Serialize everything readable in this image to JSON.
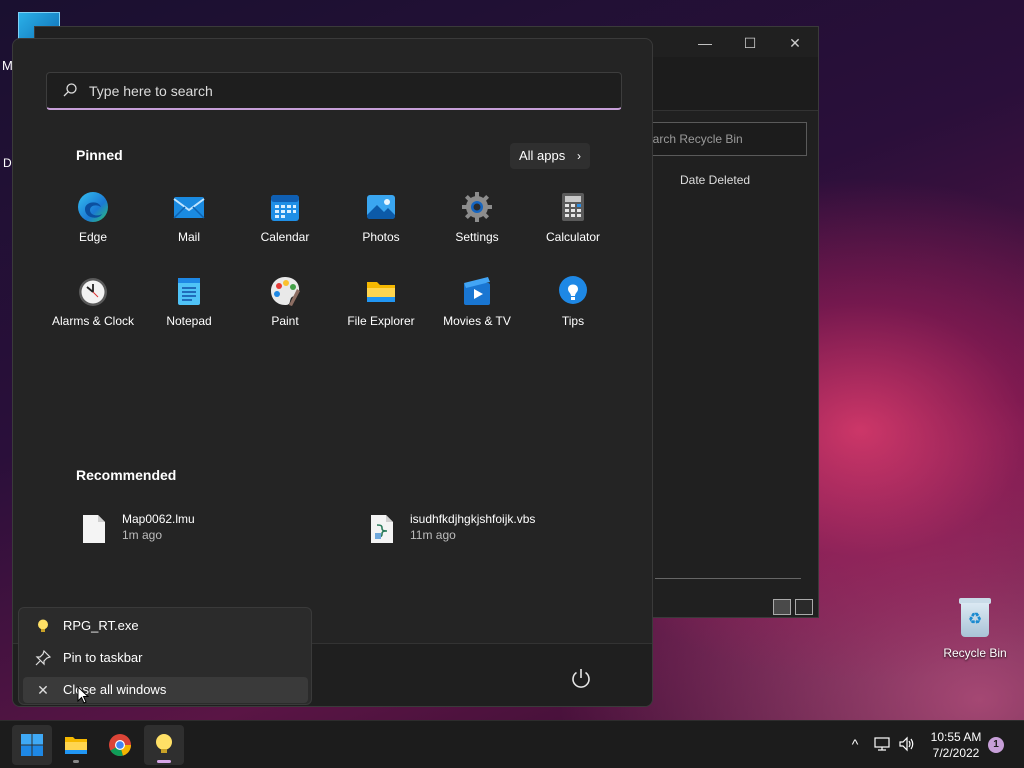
{
  "desktop": {
    "top_left_label_m": "M",
    "top_left_label_d": "D",
    "recycle_bin_label": "Recycle Bin"
  },
  "explorer": {
    "search_placeholder": "Search Recycle Bin",
    "search_visible_text": "earch Recycle Bin",
    "column_header": "Date Deleted",
    "minimize_icon": "minimize-icon",
    "maximize_icon": "maximize-icon",
    "close_icon": "close-icon"
  },
  "start_menu": {
    "search_placeholder": "Type here to search",
    "pinned_title": "Pinned",
    "all_apps_label": "All apps",
    "pinned_apps": [
      {
        "name": "Edge",
        "icon": "edge-icon"
      },
      {
        "name": "Mail",
        "icon": "mail-icon"
      },
      {
        "name": "Calendar",
        "icon": "calendar-icon"
      },
      {
        "name": "Photos",
        "icon": "photos-icon"
      },
      {
        "name": "Settings",
        "icon": "settings-icon"
      },
      {
        "name": "Calculator",
        "icon": "calculator-icon"
      },
      {
        "name": "Alarms & Clock",
        "icon": "clock-icon"
      },
      {
        "name": "Notepad",
        "icon": "notepad-icon"
      },
      {
        "name": "Paint",
        "icon": "paint-icon"
      },
      {
        "name": "File Explorer",
        "icon": "folder-icon"
      },
      {
        "name": "Movies & TV",
        "icon": "movies-icon"
      },
      {
        "name": "Tips",
        "icon": "tips-icon"
      }
    ],
    "recommended_title": "Recommended",
    "recommended": [
      {
        "name": "Map0062.lmu",
        "time": "1m ago",
        "icon": "document-icon"
      },
      {
        "name": "isudhfkdjhgkjshfoijk.vbs",
        "time": "11m ago",
        "icon": "script-icon"
      }
    ]
  },
  "jumplist": {
    "items": [
      {
        "label": "RPG_RT.exe",
        "icon": "lightbulb-icon"
      },
      {
        "label": "Pin to taskbar",
        "icon": "pin-icon"
      },
      {
        "label": "Close all windows",
        "icon": "close-icon"
      }
    ]
  },
  "taskbar": {
    "time": "10:55 AM",
    "date": "7/2/2022",
    "notification_count": "1",
    "colors": {
      "accent": "#c79fd8",
      "start_blue": "#0a84d8"
    }
  }
}
